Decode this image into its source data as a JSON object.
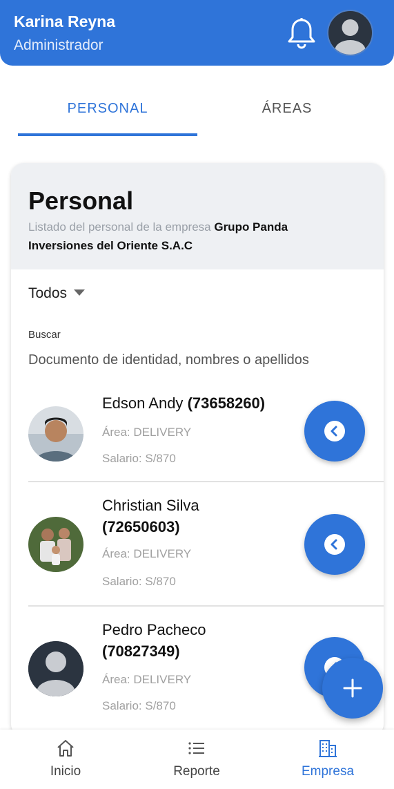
{
  "header": {
    "name": "Karina Reyna",
    "role": "Administrador"
  },
  "tabs": [
    {
      "label": "PERSONAL",
      "active": true
    },
    {
      "label": "ÁREAS",
      "active": false
    }
  ],
  "card": {
    "title": "Personal",
    "desc_prefix": "Listado del personal de la empresa ",
    "company": "Grupo Panda Inversiones del Oriente S.A.C"
  },
  "filter": {
    "selected": "Todos"
  },
  "search": {
    "label": "Buscar",
    "placeholder": "Documento de identidad, nombres o apellidos"
  },
  "employees": [
    {
      "name": "Edson Andy",
      "document": "(73658260)",
      "area": "Área: DELIVERY",
      "salary": "Salario: S/870"
    },
    {
      "name": "Christian Silva",
      "document": "(72650603)",
      "area": "Área: DELIVERY",
      "salary": "Salario: S/870"
    },
    {
      "name": "Pedro Pacheco",
      "document": "(70827349)",
      "area": "Área: DELIVERY",
      "salary": "Salario: S/870"
    }
  ],
  "bottom_nav": [
    {
      "label": "Inicio",
      "icon": "home-icon",
      "active": false
    },
    {
      "label": "Reporte",
      "icon": "list-icon",
      "active": false
    },
    {
      "label": "Empresa",
      "icon": "building-icon",
      "active": true
    }
  ],
  "colors": {
    "primary": "#2f74d9",
    "header_bg": "#2f74d9",
    "card_head_bg": "#eef0f3"
  }
}
